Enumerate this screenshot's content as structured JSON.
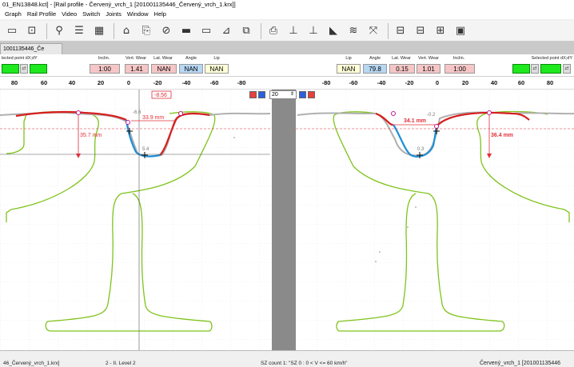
{
  "window": {
    "title": "01_EN13848.kct] - [Rail profile - Červený_vrch_1 [201001135446_Červený_vrch_1.krx]]"
  },
  "menu": [
    "Graph",
    "Rail Profile",
    "Video",
    "Switch",
    "Joints",
    "Window",
    "Help"
  ],
  "toolbar_icons": [
    "zoom-fit-icon",
    "zoom-rect-icon",
    "magnifier-icon",
    "list-icon",
    "grid-icon",
    "profile-icon",
    "export-icon",
    "overlay-icon",
    "measure-icon",
    "flat-icon",
    "compare-icon",
    "layers-icon",
    "print-icon",
    "rail-left-icon",
    "rail-right-icon",
    "wheel-icon",
    "wear-icon",
    "expand-icon",
    "split-h-icon",
    "split-v-icon",
    "tile-icon",
    "window-icon"
  ],
  "document_tab": {
    "label": "1001135446_Če"
  },
  "left_panel": {
    "selected_point_label": "lected point dX;dY",
    "inclin": {
      "label": "Inclin.",
      "value": "1:00"
    },
    "vert_wear": {
      "label": "Vert. Wear",
      "value": "1.41"
    },
    "lat_wear": {
      "label": "Lat. Wear",
      "value": "NAN"
    },
    "angle": {
      "label": "Angle",
      "value": "NAN"
    },
    "lip": {
      "label": "Lip",
      "value": "NAN"
    }
  },
  "right_panel": {
    "lip": {
      "label": "Lip",
      "value": "NAN"
    },
    "angle": {
      "label": "Angle",
      "value": "79.8"
    },
    "lat_wear": {
      "label": "Lat. Wear",
      "value": "0.15"
    },
    "vert_wear": {
      "label": "Vert. Wear",
      "value": "1.01"
    },
    "inclin": {
      "label": "Inclin.",
      "value": "1:00"
    },
    "selected_point_label": "Selected point dX;dY"
  },
  "left_ruler": [
    "80",
    "60",
    "40",
    "20",
    "0",
    "-20",
    "-40",
    "-60",
    "-80"
  ],
  "right_ruler": [
    "-80",
    "-60",
    "-40",
    "-20",
    "0",
    "20",
    "40",
    "60",
    "80"
  ],
  "left_plot": {
    "cursor_readout": "-8.56",
    "height_label": "35.7 mm",
    "width_label": "33.9 mm",
    "small_label_top": "-6.6",
    "small_label_bottom": "5.4"
  },
  "right_plot": {
    "height_label": "36.4 mm",
    "width_label": "34.1 mm",
    "small_label_top": "-0.2",
    "small_label_bottom": "0.3"
  },
  "zoom_spinner": {
    "value": "20"
  },
  "status": {
    "file": "46_Červený_vrch_1.krx]",
    "level": "2 - II. Level 2",
    "sz_count": "SZ count 1: \"SZ 0 : 0 < V <= 60 km/h\"",
    "right": "Červený_vrch_1 [201001135446"
  },
  "colors": {
    "profile_green": "#7fc31c",
    "measured_red": "#d61f1f",
    "measured_blue": "#1d8fd6",
    "reference_gray": "#a8a8a8",
    "dimension_red": "#e0303a",
    "marker_magenta": "#c2188f"
  }
}
